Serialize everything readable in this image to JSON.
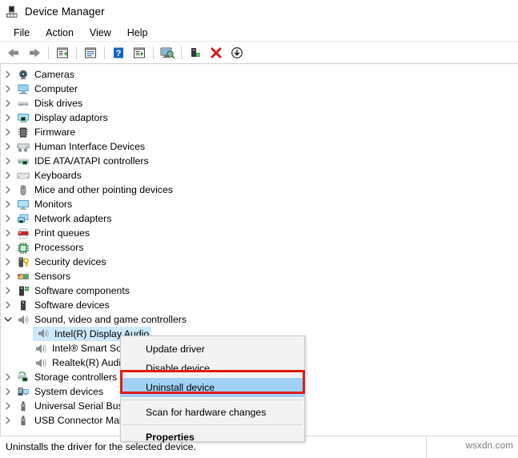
{
  "window": {
    "title": "Device Manager",
    "icon": "device-manager-icon"
  },
  "menubar": {
    "items": [
      {
        "label": "File"
      },
      {
        "label": "Action"
      },
      {
        "label": "View"
      },
      {
        "label": "Help"
      }
    ]
  },
  "toolbar": {
    "buttons": [
      {
        "icon": "back-arrow-icon",
        "name": "back-button"
      },
      {
        "icon": "forward-arrow-icon",
        "name": "forward-button"
      },
      {
        "separator": true
      },
      {
        "icon": "show-hidden-devices-icon",
        "name": "show-hidden-devices-button"
      },
      {
        "separator": true
      },
      {
        "icon": "properties-icon",
        "name": "properties-button"
      },
      {
        "separator": true
      },
      {
        "icon": "help-icon",
        "name": "help-button"
      },
      {
        "icon": "device-view-icon",
        "name": "device-view-button"
      },
      {
        "separator": true
      },
      {
        "icon": "scan-hardware-icon",
        "name": "scan-for-hardware-changes-button"
      },
      {
        "separator": true
      },
      {
        "icon": "update-driver-icon",
        "name": "update-driver-button"
      },
      {
        "icon": "uninstall-device-icon",
        "name": "uninstall-device-button"
      },
      {
        "icon": "disable-device-icon",
        "name": "disable-device-button"
      }
    ]
  },
  "tree": {
    "rows": [
      {
        "label": "Cameras",
        "icon": "camera-icon",
        "chevron": "collapsed",
        "indent": 0
      },
      {
        "label": "Computer",
        "icon": "computer-icon",
        "chevron": "collapsed",
        "indent": 0
      },
      {
        "label": "Disk drives",
        "icon": "disk-drive-icon",
        "chevron": "collapsed",
        "indent": 0
      },
      {
        "label": "Display adaptors",
        "icon": "display-adapter-icon",
        "chevron": "collapsed",
        "indent": 0
      },
      {
        "label": "Firmware",
        "icon": "firmware-icon",
        "chevron": "collapsed",
        "indent": 0
      },
      {
        "label": "Human Interface Devices",
        "icon": "hid-icon",
        "chevron": "collapsed",
        "indent": 0
      },
      {
        "label": "IDE ATA/ATAPI controllers",
        "icon": "ide-controller-icon",
        "chevron": "collapsed",
        "indent": 0
      },
      {
        "label": "Keyboards",
        "icon": "keyboard-icon",
        "chevron": "collapsed",
        "indent": 0
      },
      {
        "label": "Mice and other pointing devices",
        "icon": "mouse-icon",
        "chevron": "collapsed",
        "indent": 0
      },
      {
        "label": "Monitors",
        "icon": "monitor-icon",
        "chevron": "collapsed",
        "indent": 0
      },
      {
        "label": "Network adapters",
        "icon": "network-adapter-icon",
        "chevron": "collapsed",
        "indent": 0
      },
      {
        "label": "Print queues",
        "icon": "printer-icon",
        "chevron": "collapsed",
        "indent": 0
      },
      {
        "label": "Processors",
        "icon": "processor-icon",
        "chevron": "collapsed",
        "indent": 0
      },
      {
        "label": "Security devices",
        "icon": "security-device-icon",
        "chevron": "collapsed",
        "indent": 0
      },
      {
        "label": "Sensors",
        "icon": "sensor-icon",
        "chevron": "collapsed",
        "indent": 0
      },
      {
        "label": "Software components",
        "icon": "software-component-icon",
        "chevron": "collapsed",
        "indent": 0
      },
      {
        "label": "Software devices",
        "icon": "software-device-icon",
        "chevron": "collapsed",
        "indent": 0
      },
      {
        "label": "Sound, video and game controllers",
        "icon": "sound-controller-icon",
        "chevron": "expanded",
        "indent": 0
      },
      {
        "label": "Intel(R) Display Audio",
        "icon": "speaker-icon",
        "chevron": "none",
        "indent": 1,
        "selected": true
      },
      {
        "label": "Intel® Smart Sound Technology (Intel® SST)",
        "icon": "speaker-icon",
        "chevron": "none",
        "indent": 1
      },
      {
        "label": "Realtek(R) Audio",
        "icon": "speaker-icon",
        "chevron": "none",
        "indent": 1
      },
      {
        "label": "Storage controllers",
        "icon": "storage-controller-icon",
        "chevron": "collapsed",
        "indent": 0
      },
      {
        "label": "System devices",
        "icon": "system-device-icon",
        "chevron": "collapsed",
        "indent": 0
      },
      {
        "label": "Universal Serial Bus controllers",
        "icon": "usb-icon",
        "chevron": "collapsed",
        "indent": 0
      },
      {
        "label": "USB Connector Managers",
        "icon": "usb-icon",
        "chevron": "collapsed",
        "indent": 0
      }
    ]
  },
  "context_menu": {
    "items": [
      {
        "label": "Update driver",
        "highlighted": false,
        "bold": false
      },
      {
        "label": "Disable device",
        "highlighted": false,
        "bold": false
      },
      {
        "label": "Uninstall device",
        "highlighted": true,
        "bold": false
      },
      {
        "separator": true
      },
      {
        "label": "Scan for hardware changes",
        "highlighted": false,
        "bold": false
      },
      {
        "separator": true
      },
      {
        "label": "Properties",
        "highlighted": false,
        "bold": true
      }
    ],
    "highlight_color": "#9fd2f5",
    "annotation_color": "#e01b18"
  },
  "statusbar": {
    "text": "Uninstalls the driver for the selected device."
  },
  "watermark": {
    "text": "wsxdn.com"
  }
}
